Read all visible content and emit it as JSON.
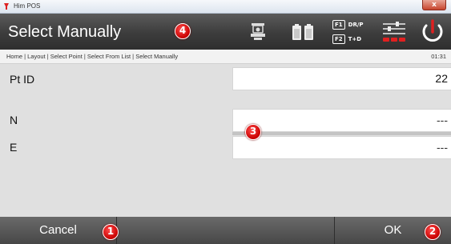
{
  "window": {
    "title": "Him POS",
    "close_glyph": "x"
  },
  "header": {
    "title": "Select Manually",
    "icons": [
      "instrument-tripod-icon",
      "battery-icon",
      "fkey-assignment-icon",
      "settings-sliders-icon",
      "power-icon"
    ],
    "fkeys": [
      {
        "key": "F1",
        "label": "DR/P"
      },
      {
        "key": "F2",
        "label": "T+D"
      }
    ]
  },
  "breadcrumb": {
    "path": "Home | Layout | Select Point | Select From List | Select Manually",
    "time": "01:31"
  },
  "form": {
    "fields": [
      {
        "label": "Pt ID",
        "value": "22"
      },
      {
        "label": "N",
        "value": "---"
      },
      {
        "label": "E",
        "value": "---"
      }
    ]
  },
  "footer": {
    "cancel_label": "Cancel",
    "ok_label": "OK"
  },
  "callouts": [
    "1",
    "2",
    "3",
    "4"
  ],
  "colors": {
    "accent": "#e00000",
    "header_bg": "#3c3c3c",
    "form_bg": "#e0e0e0"
  }
}
